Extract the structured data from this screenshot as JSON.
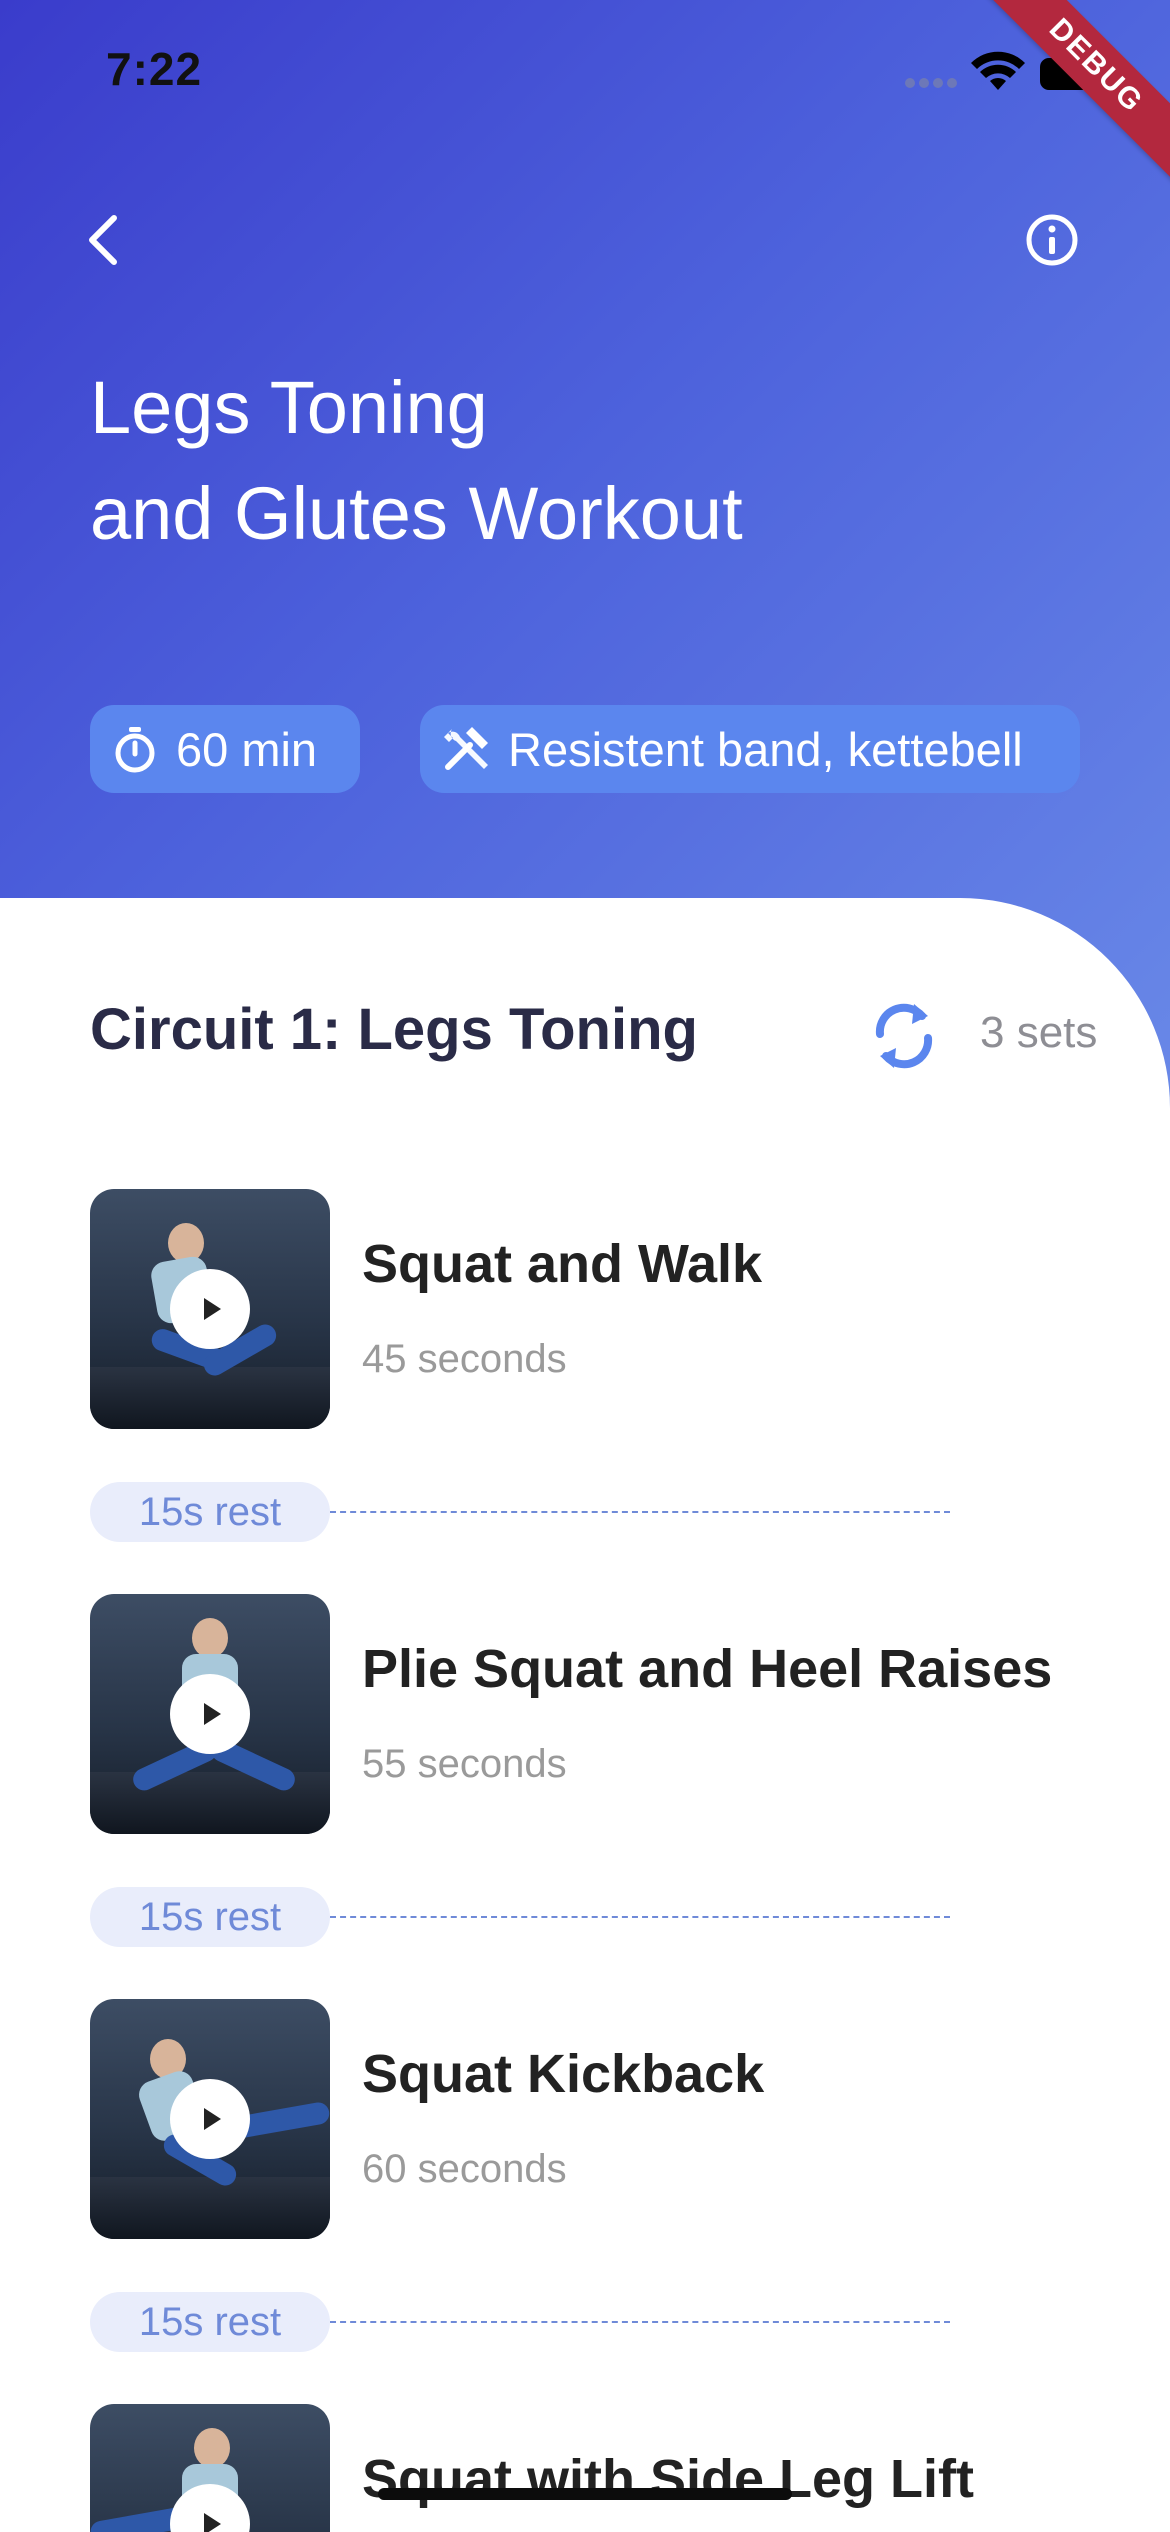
{
  "status_bar": {
    "time": "7:22"
  },
  "debug_banner": "DEBUG",
  "header": {
    "title_line1": "Legs Toning",
    "title_line2": "and Glutes Workout",
    "duration": "60 min",
    "equipment": "Resistent band, kettebell"
  },
  "circuit": {
    "title": "Circuit 1: Legs Toning",
    "sets": "3 sets",
    "exercises": [
      {
        "name": "Squat and Walk",
        "duration": "45 seconds"
      },
      {
        "name": "Plie Squat and Heel Raises",
        "duration": "55 seconds"
      },
      {
        "name": "Squat Kickback",
        "duration": "60 seconds"
      },
      {
        "name": "Squat with Side Leg Lift",
        "duration": ""
      }
    ],
    "rest_label": "15s rest"
  },
  "colors": {
    "hero_gradient_start": "#3a3ccb",
    "hero_gradient_end": "#6a8ae8",
    "chip_bg": "#5b86ee",
    "accent": "#5b86ee",
    "title_text": "#2a2b47",
    "debug_ribbon": "#b3283e"
  },
  "icons": {
    "back": "chevron-left-icon",
    "info": "info-icon",
    "timer": "timer-icon",
    "tools": "tools-icon",
    "repeat": "repeat-icon",
    "play": "play-icon"
  }
}
